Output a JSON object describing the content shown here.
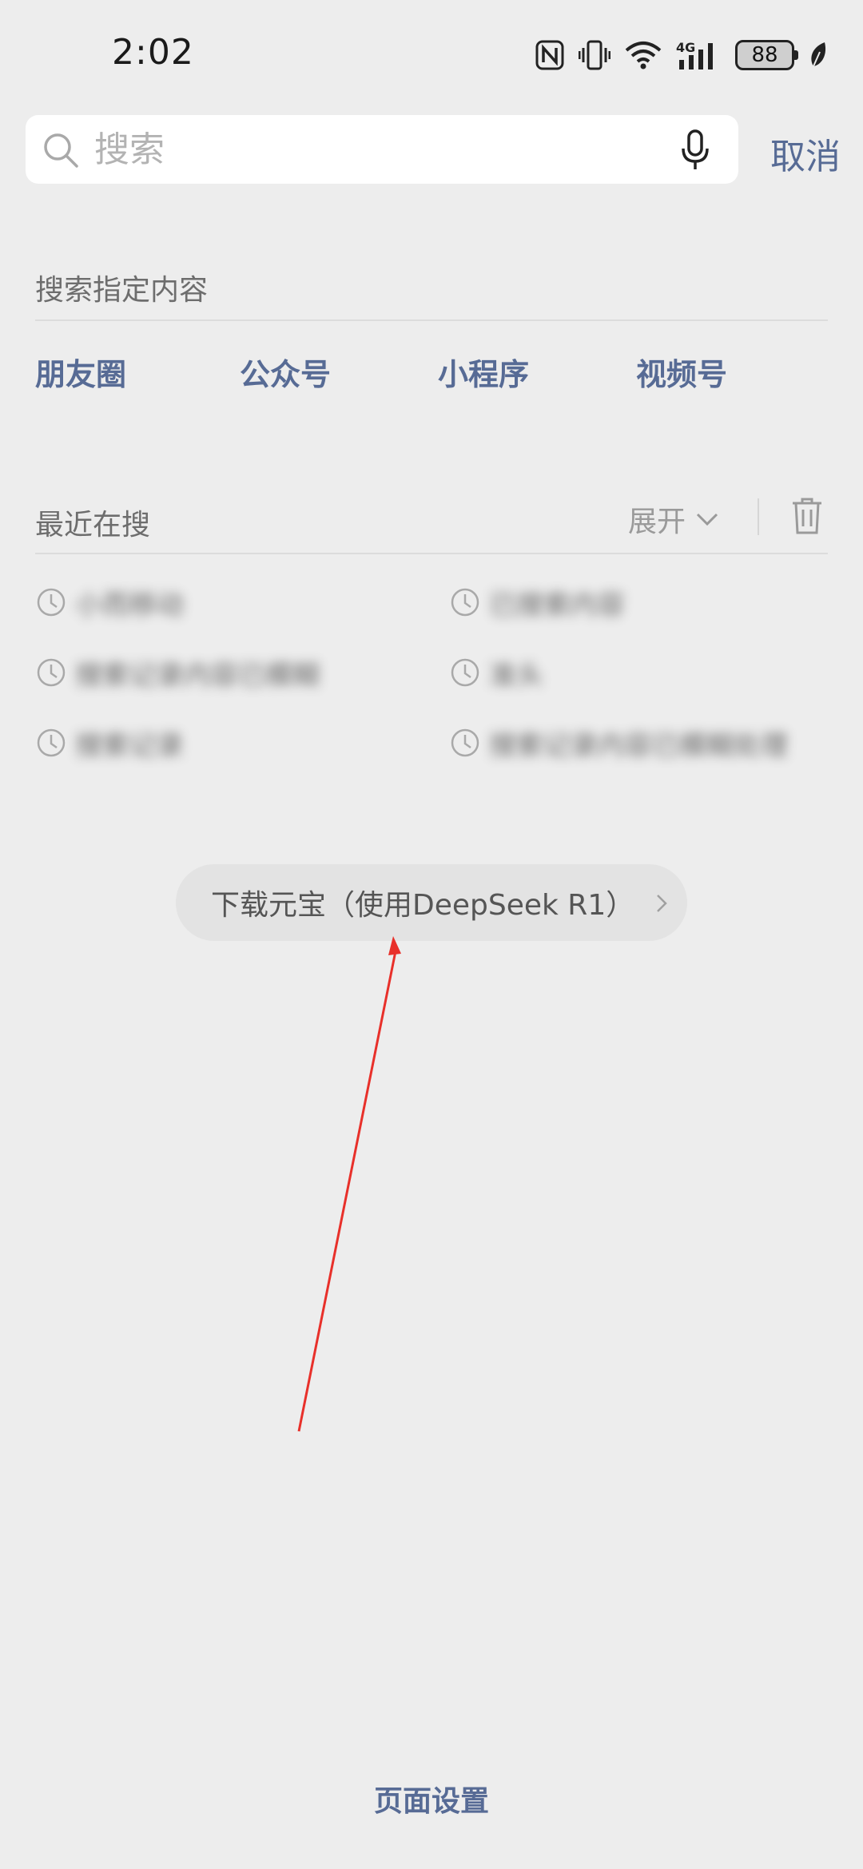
{
  "status_bar": {
    "time": "2:02",
    "network": "4G",
    "battery": "88",
    "icons": [
      "nfc-icon",
      "vibrate-icon",
      "wifi-icon",
      "signal-icon",
      "battery-icon",
      "leaf-icon"
    ]
  },
  "search": {
    "placeholder": "搜索",
    "value": "",
    "cancel_label": "取消"
  },
  "specified_content": {
    "title": "搜索指定内容",
    "categories": [
      {
        "label": "朋友圈"
      },
      {
        "label": "公众号"
      },
      {
        "label": "小程序"
      },
      {
        "label": "视频号"
      }
    ]
  },
  "recent": {
    "title": "最近在搜",
    "expand_label": "展开",
    "items": [
      {
        "text": "小而移动"
      },
      {
        "text": "已搜索内容"
      },
      {
        "text": "搜索记录内容已模糊"
      },
      {
        "text": "准头"
      },
      {
        "text": "搜索记录"
      },
      {
        "text": "搜索记录内容已模糊处理"
      }
    ]
  },
  "promo": {
    "label": "下载元宝（使用DeepSeek R1）"
  },
  "footer": {
    "page_settings": "页面设置"
  },
  "colors": {
    "background": "#ededed",
    "link": "#576b95",
    "annotation_arrow": "#e8302a"
  }
}
